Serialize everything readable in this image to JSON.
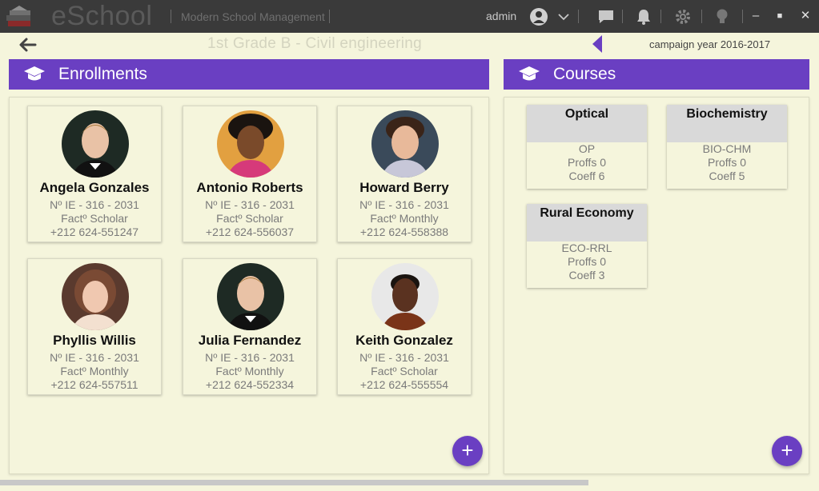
{
  "titlebar": {
    "app_name": "eSchool",
    "tagline": "Modern School Management",
    "user": "admin",
    "icons": [
      "books-logo-icon",
      "user-avatar-icon",
      "chevron-down-icon",
      "chat-icon",
      "bell-icon",
      "gear-icon",
      "lightbulb-icon"
    ],
    "window_buttons": {
      "minimize": "–",
      "maximize": "■",
      "close": "✕"
    }
  },
  "subbar": {
    "class_title": "1st Grade B - Civil engineering",
    "campaign": "campaign year 2016-2017"
  },
  "enrollments": {
    "title": "Enrollments",
    "students": [
      {
        "name": "Angela Gonzales",
        "number": "Nº IE - 316 - 2031",
        "facturation": "Factº Scholar",
        "phone": "+212 624-551247"
      },
      {
        "name": "Antonio Roberts",
        "number": "Nº IE - 316 - 2031",
        "facturation": "Factº Scholar",
        "phone": "+212 624-556037"
      },
      {
        "name": "Howard Berry",
        "number": "Nº IE - 316 - 2031",
        "facturation": "Factº Monthly",
        "phone": "+212 624-558388"
      },
      {
        "name": "Phyllis Willis",
        "number": "Nº IE - 316 - 2031",
        "facturation": "Factº Monthly",
        "phone": "+212 624-557511"
      },
      {
        "name": "Julia Fernandez",
        "number": "Nº IE - 316 - 2031",
        "facturation": "Factº Monthly",
        "phone": "+212 624-552334"
      },
      {
        "name": "Keith Gonzalez",
        "number": "Nº IE - 316 - 2031",
        "facturation": "Factº Scholar",
        "phone": "+212 624-555554"
      }
    ],
    "add_label": "+"
  },
  "courses": {
    "title": "Courses",
    "items": [
      {
        "name": "Optical",
        "code": "OP",
        "profs": "Proffs 0",
        "coeff": "Coeff 6"
      },
      {
        "name": "Biochemistry",
        "code": "BIO-CHM",
        "profs": "Proffs 0",
        "coeff": "Coeff 5"
      },
      {
        "name": "Rural Economy",
        "code": "ECO-RRL",
        "profs": "Proffs 0",
        "coeff": "Coeff 3"
      }
    ],
    "add_label": "+"
  },
  "colors": {
    "accent": "#6a3fc2",
    "titlebar": "#3a3a3a",
    "background": "#f5f5dc"
  }
}
